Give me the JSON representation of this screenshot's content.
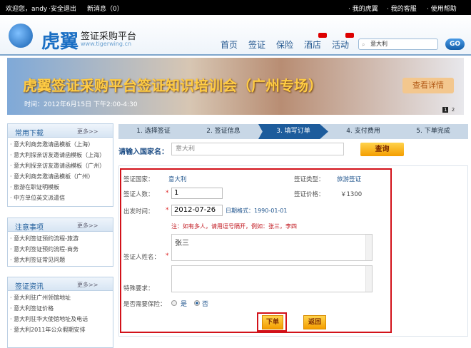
{
  "topbar": {
    "welcome": "欢迎您，andy",
    "logout": "·安全退出",
    "messages": "新消息（0）",
    "links": [
      "· 我的虎翼",
      "· 我的客服",
      "· 使用帮助"
    ]
  },
  "header": {
    "logo_text": "虎翼",
    "logo_sub": "签证采购平台",
    "logo_url": "www.tigerwing.cn",
    "nav": [
      "首页",
      "签证",
      "保险",
      "酒店",
      "活动"
    ],
    "new_badge_on": [
      "酒店",
      "活动"
    ],
    "search_value": "意大利",
    "go": "GO"
  },
  "banner": {
    "title": "虎翼签证采购平台签证知识培训会（广州专场）",
    "time": "时间：2012年6月15日 下午2:00-4:30",
    "button": "查看详情",
    "pages": [
      "1",
      "2"
    ]
  },
  "sidebar": [
    {
      "title": "常用下载",
      "more": "更多>>",
      "items": [
        "· 意大利商务邀请函模板（上海）",
        "· 意大利探亲访友邀请函模板（上海）",
        "· 意大利探亲访友邀请函模板（广州）",
        "· 意大利商务邀请函模板（广州）",
        "· 旅游在职证明模板",
        "· 中方单位英文派遣信"
      ]
    },
    {
      "title": "注意事项",
      "more": "更多>>",
      "items": [
        "·  意大利签证预约流程-旅游",
        "·  意大利签证预约流程-商务",
        "·  意大利签证常见问题"
      ]
    },
    {
      "title": "签证资讯",
      "more": "更多>>",
      "items": [
        "·  意大利驻广州领馆地址",
        "·  意大利签证价格",
        "·  意大利驻华大使馆地址及电话",
        "·  意大利2011年公众假期安排"
      ]
    }
  ],
  "steps": [
    "1. 选择签证",
    "2. 签证信息",
    "3. 填写订单",
    "4. 支付费用",
    "5. 下单完成"
  ],
  "active_step": 3,
  "search": {
    "label": "请输入国家名：",
    "value": "意大利",
    "button": "查询"
  },
  "form": {
    "country_label": "签证国家：",
    "country": "意大利",
    "type_label": "签证类型：",
    "type": "旅游签证",
    "count_label": "签证人数：",
    "count": "1",
    "price_label": "签证价格：",
    "price": "￥1300",
    "date_label": "出发时间：",
    "date": "2012-07-26",
    "date_hint": "日期格式：1990-01-01",
    "note": "注：如有多人，请用逗号隔开，例如：张三，李四",
    "names_label": "签证人姓名：",
    "names": "张三",
    "special_label": "特殊要求：",
    "special": "",
    "insurance_label": "是否需要保险：",
    "yes": "是",
    "no": "否",
    "insurance_selected": "否",
    "submit": "下单",
    "back": "返回",
    "required_mark": "*"
  },
  "colors": {
    "accent": "#1d5c9c",
    "highlight": "#d2121a",
    "button": "#f5a800"
  }
}
